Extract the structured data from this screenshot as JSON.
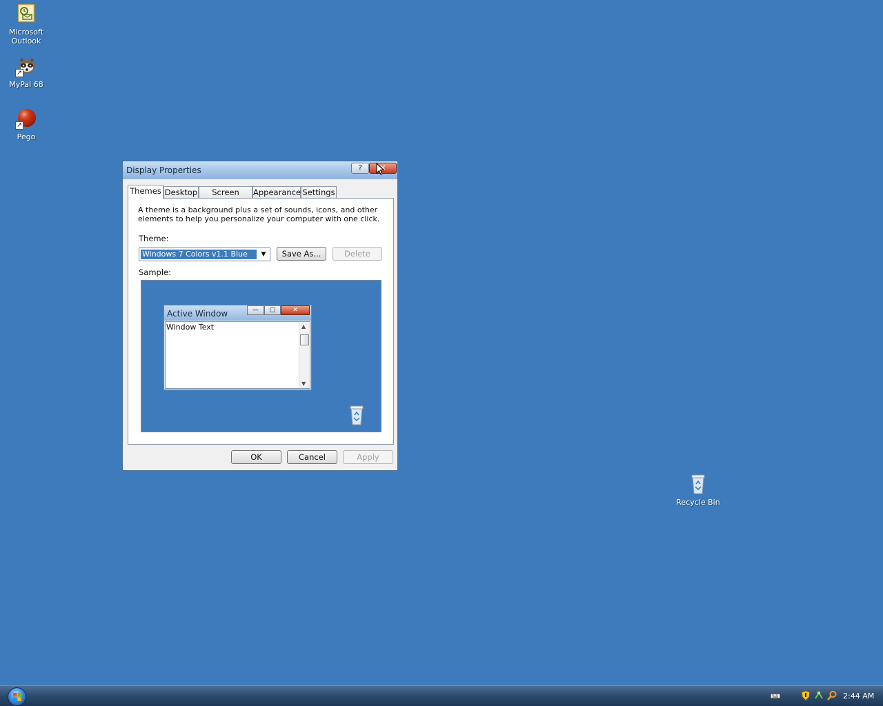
{
  "desktop": {
    "icons": [
      {
        "label": "Microsoft Outlook"
      },
      {
        "label": "MyPal 68"
      },
      {
        "label": "Pego"
      },
      {
        "label": "Recycle Bin"
      }
    ],
    "background_color": "#3d7bbc"
  },
  "dialog": {
    "title": "Display Properties",
    "help_glyph": "?",
    "close_glyph": "✕",
    "tabs": [
      {
        "label": "Themes",
        "active": true
      },
      {
        "label": "Desktop"
      },
      {
        "label": "Screen Saver"
      },
      {
        "label": "Appearance"
      },
      {
        "label": "Settings"
      }
    ],
    "themes_panel": {
      "description": "A theme is a background plus a set of sounds, icons, and other elements to help you personalize your computer with one click.",
      "theme_label": "Theme:",
      "theme_value": "Windows 7 Colors v1.1 Blue",
      "save_as_label": "Save As...",
      "delete_label": "Delete",
      "sample_label": "Sample:",
      "sample": {
        "window_title": "Active Window",
        "window_text": "Window Text"
      }
    },
    "buttons": {
      "ok": "OK",
      "cancel": "Cancel",
      "apply": "Apply"
    }
  },
  "taskbar": {
    "clock": "2:44 AM",
    "tray_icons": [
      "keyboard-icon",
      "security-shield-icon",
      "network-icon",
      "search-icon"
    ]
  }
}
